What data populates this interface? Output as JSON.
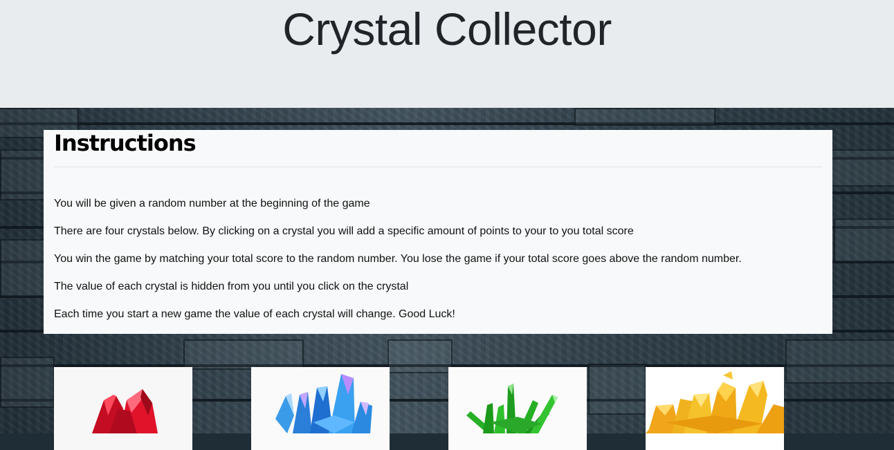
{
  "header": {
    "title": "Crystal Collector"
  },
  "instructions": {
    "heading": "Instructions",
    "lines": [
      "You will be given a random number at the beginning of the game",
      "There are four crystals below. By clicking on a crystal you will add a specific amount of points to your to you total score",
      "You win the game by matching your total score to the random number. You lose the game if your total score goes above the random number.",
      "The value of each crystal is hidden from you until you click on the crystal",
      "Each time you start a new game the value of each crystal will change. Good Luck!"
    ]
  },
  "crystals": [
    {
      "icon": "red-crystal-icon",
      "color": "#d8102a"
    },
    {
      "icon": "blue-crystal-icon",
      "color": "#2a8fe0"
    },
    {
      "icon": "green-crystal-icon",
      "color": "#1fa51f"
    },
    {
      "icon": "yellow-crystal-icon",
      "color": "#f2b51a"
    }
  ]
}
